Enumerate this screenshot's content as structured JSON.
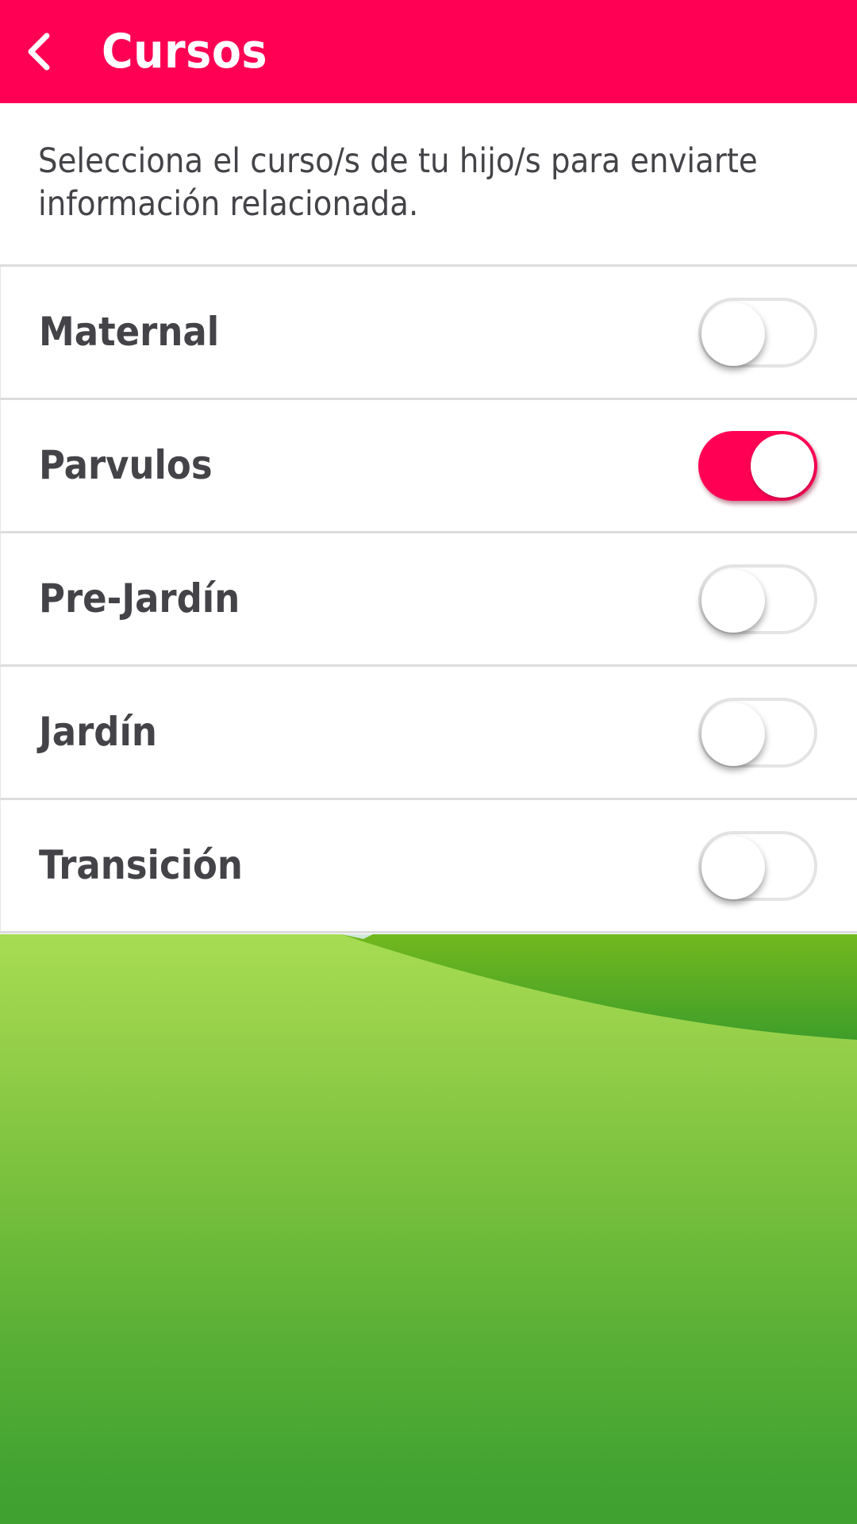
{
  "header": {
    "back_icon": "chevron-left-icon",
    "title": "Cursos"
  },
  "description": "Selecciona el curso/s de tu hijo/s para enviarte información relacionada.",
  "courses": [
    {
      "label": "Maternal",
      "enabled": false
    },
    {
      "label": "Parvulos",
      "enabled": true
    },
    {
      "label": "Pre-Jardín",
      "enabled": false
    },
    {
      "label": "Jardín",
      "enabled": false
    },
    {
      "label": "Transición",
      "enabled": false
    }
  ],
  "colors": {
    "accent": "#FF0055",
    "text": "#444448",
    "divider": "#DCDCDC",
    "grass_light": "#A6DC52",
    "grass_dark": "#40A030"
  }
}
